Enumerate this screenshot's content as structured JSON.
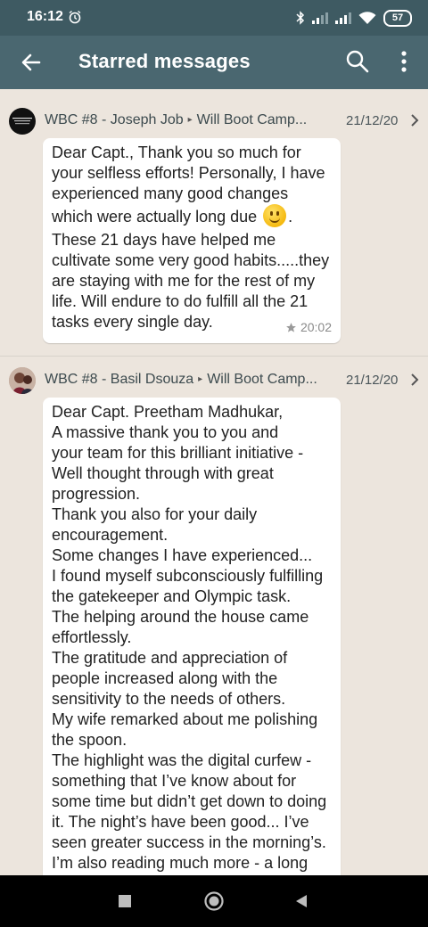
{
  "status_bar": {
    "time": "16:12",
    "battery": "57",
    "icons": [
      "alarm-icon",
      "bluetooth-icon",
      "signal-icon",
      "signal-icon",
      "wifi-icon",
      "battery-icon"
    ]
  },
  "app_bar": {
    "title": "Starred messages",
    "background": "#4a6770",
    "icons": [
      "back-arrow-icon",
      "search-icon",
      "more-vert-icon"
    ]
  },
  "messages": [
    {
      "sender": "WBC #8 - Joseph Job",
      "group": "Will Boot Camp...",
      "date": "21/12/20",
      "text_before_emoji": "Dear Capt., Thank you so much for your selfless efforts! Personally, I have experienced many good changes which were actually long due",
      "text_after_emoji": ".",
      "text_2": "These 21 days have helped me cultivate some very good habits.....they are staying with me for the rest of my life. Will endure to do fulfill all the 21 tasks every single day.",
      "time": "20:02"
    },
    {
      "sender": "WBC #8 - Basil Dsouza",
      "group": "Will Boot Camp...",
      "date": "21/12/20",
      "lines": [
        "Dear Capt. Preetham Madhukar,",
        "A massive thank you to you and your team for this brilliant initiative - Well thought through with great progression.",
        "Thank you also for your daily encouragement.",
        "Some changes I have experienced...",
        "I found myself subconsciously fulfilling the gatekeeper and Olympic task.",
        "The helping around the house came effortlessly.",
        "The gratitude and appreciation of people increased along with the sensitivity to the needs of others.",
        "My wife remarked about me polishing the spoon.",
        "The highlight was the digital curfew - something that I’ve know about for some time but didn’t get down to doing it. The night’s have been good... I’ve seen greater success in the morning’s.",
        "I’m also reading much more - a long"
      ]
    }
  ]
}
